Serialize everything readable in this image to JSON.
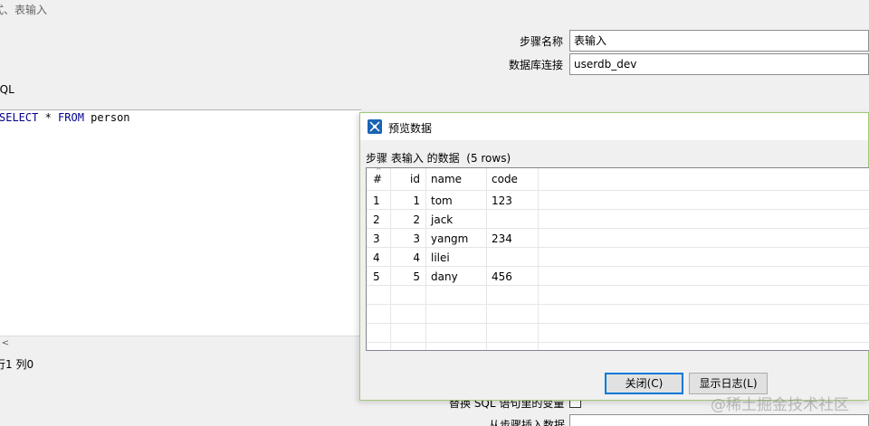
{
  "dialog": {
    "title": "表输入",
    "title_prefix_glyph": "式"
  },
  "form": {
    "step_name_label": "步骤名称",
    "step_name_value": "表输入",
    "db_conn_label": "数据库连接",
    "db_conn_value": "userdb_dev",
    "sql_label": "SQL"
  },
  "sql": {
    "kw1": "SELECT",
    "mid1": " * ",
    "kw2": "FROM",
    "rest": " person"
  },
  "status": "行1 列0",
  "lower": {
    "replace_var_label": "替换 SQL 语句里的变量",
    "from_step_label": "从步骤插入数据"
  },
  "preview": {
    "title": "预览数据",
    "caption": "步骤 表输入 的数据  (5 rows)",
    "columns": [
      "#",
      "id",
      "name",
      "code"
    ],
    "rows": [
      [
        "1",
        "1",
        "tom",
        "123"
      ],
      [
        "2",
        "2",
        "jack",
        ""
      ],
      [
        "3",
        "3",
        "yangm",
        "234"
      ],
      [
        "4",
        "4",
        "lilei",
        ""
      ],
      [
        "5",
        "5",
        "dany",
        "456"
      ]
    ],
    "close_label": "关闭(C)",
    "log_label": "显示日志(L)"
  },
  "watermark": "@稀土掘金技术社区",
  "colors": {
    "accent": "#0078d7",
    "sql_keyword": "#00008b",
    "dialog_border": "#a0c878"
  }
}
